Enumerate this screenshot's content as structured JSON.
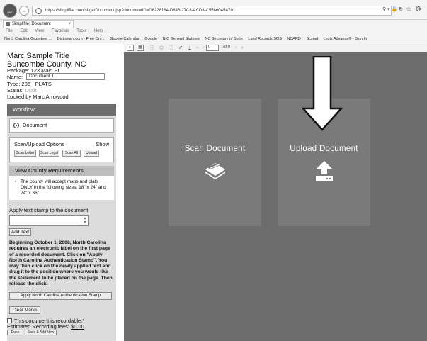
{
  "browser": {
    "url": "https://simplifile.com/sf/getDocument.jsp?documentID=D6228184-D846-27C8-ACD3-C5586045A701",
    "search_icon": "search-icon",
    "tab_title": "Simplifile: Document",
    "tab_close": "×",
    "menu": [
      "File",
      "Edit",
      "View",
      "Favorites",
      "Tools",
      "Help"
    ],
    "favorites": [
      "North Carolina Gazetteer ...",
      "Dictionary.com - Free Onl...",
      "Google Calendar",
      "Google",
      "N C General Statutes",
      "NC Secretary of State",
      "Land Records SOS",
      "NCARD",
      "Scsnet",
      "Lexis Advance® - Sign In"
    ]
  },
  "doc": {
    "title": "Marc Sample Title",
    "county": "Buncombe County, NC",
    "package_label": "Package:",
    "package_value": "123 Main St",
    "name_label": "Name:",
    "name_value": "Document 1",
    "type_label": "Type:",
    "type_value": "206 - PLATS",
    "status_label": "Status:",
    "status_value": "Draft",
    "locked": "Locked by Marc Arrowood"
  },
  "workflow": {
    "header": "Workflow:",
    "document_option": "Document",
    "scan_title": "Scan/Upload Options",
    "scan_show": "Show",
    "scan_buttons": [
      "Scan Letter",
      "Scan Legal",
      "Scan All",
      "Upload"
    ],
    "req_header": "View County Requirements",
    "req_text": "The county will accept maps and plats ONLY in the following sizes: 18\" x 24\" and 24\" x 36\"",
    "stamp_label": "Apply text stamp to the document",
    "add_text": "Add Text",
    "notice": "Beginning October 1, 2008, North Carolina requires an electronic label on the first page of a recorded document. Click on \"Apply North Carolina Authentication Stamp\". You may then click on the newly applied text and drag it to the position where you would like the statement to be placed on the page. Then, release the click.",
    "auth_button": "Apply North Carolina Authentication Stamp",
    "clear_marks": "Clear Marks"
  },
  "footer": {
    "recordable": "This document is recordable.*",
    "fees_label": "Estimated Recording fees:",
    "fees_value": "$0.00",
    "fees_suffix": ".",
    "done": "Done",
    "save_add": "Save & Add New"
  },
  "viewer": {
    "page_value": "0",
    "page_of": "of 0",
    "scan_label": "Scan Document",
    "upload_label": "Upload Document"
  }
}
